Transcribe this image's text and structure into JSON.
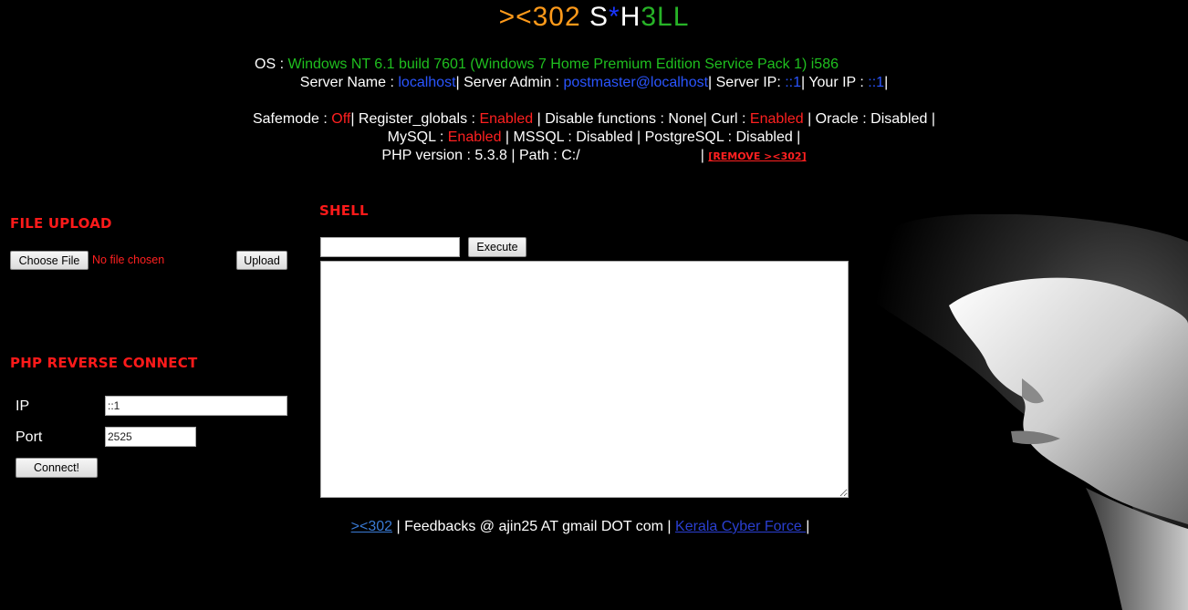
{
  "header": {
    "part1": "><302",
    "part2": " S",
    "part3": "*",
    "part4": "H",
    "part5": "3LL"
  },
  "sysinfo": {
    "os_label": "OS : ",
    "os_value": "Windows NT  6.1 build 7601 (Windows 7 Home Premium Edition Service Pack 1) i586",
    "server_name_label": "Server Name : ",
    "server_name": "localhost",
    "server_admin_label": "| Server Admin : ",
    "server_admin": "postmaster@localhost",
    "server_ip_label": "| Server IP: ",
    "server_ip": "::1",
    "your_ip_label": "| Your IP : ",
    "your_ip": "::1",
    "end_sep": "|"
  },
  "features": {
    "safemode_label": "Safemode : ",
    "safemode": "Off",
    "register_globals_label": "| Register_globals : ",
    "register_globals": "Enabled",
    "disable_functions_label": " | Disable functions : None| Curl : ",
    "curl": "Enabled",
    "oracle_label": " | Oracle : Disabled |",
    "mysql_label": "MySQL : ",
    "mysql": "Enabled",
    "mssql_label": " | MSSQL : Disabled | PostgreSQL : Disabled |",
    "php_version_label": "PHP version : 5.3.8 | Path : C:/",
    "path_sep": "|",
    "remove_link": "[REMOVE ><302]"
  },
  "upload": {
    "title": "FILE UPLOAD",
    "choose_button": "Choose File",
    "no_file": "No file chosen",
    "upload_button": "Upload"
  },
  "reverse": {
    "title": "PHP REVERSE CONNECT",
    "ip_label": "IP",
    "ip_value": "::1",
    "port_label": "Port",
    "port_value": "2525",
    "connect_button": "Connect!"
  },
  "shell": {
    "title": "SHELL",
    "command_value": "",
    "execute_button": "Execute",
    "output": ""
  },
  "footer": {
    "link1": "><302",
    "text": " | Feedbacks @ ajin25 AT gmail DOT com | ",
    "link2": "Kerala Cyber Force ",
    "end": "|"
  },
  "colors": {
    "background": "#000000",
    "section_title": "#ff1a1a",
    "enabled": "#ff2020",
    "link_blue": "#2a55ff",
    "os_green": "#1fbf1f",
    "logo_orange": "#ff9a1a"
  }
}
